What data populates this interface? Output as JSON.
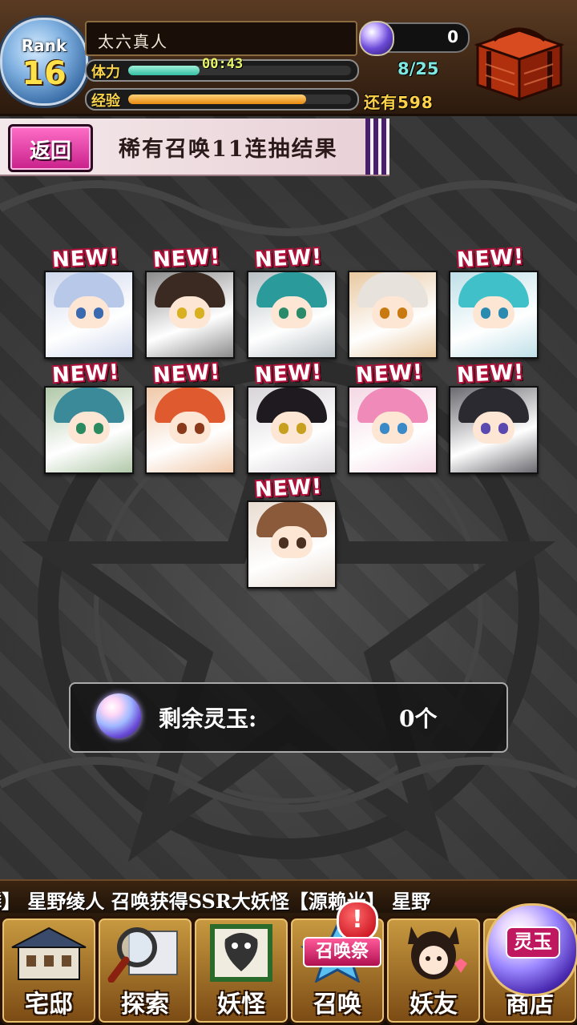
{
  "player": {
    "rank_label": "Rank",
    "rank": "16",
    "name": "太六真人",
    "stamina_label": "体力",
    "stamina_timer": "00:43",
    "stamina": "8/25",
    "stamina_fraction": 0.32,
    "exp_label": "经验",
    "exp_remaining": "还有598",
    "exp_fraction": 0.8,
    "jade": "0"
  },
  "header": {
    "back_label": "返回",
    "title": "稀有召唤11连抽结果"
  },
  "results": {
    "new_label": "NEW!",
    "cards": [
      {
        "hair": "#b8c8e8",
        "bg": "#cfd8ec",
        "eyes": "#3a6ab0",
        "new": true
      },
      {
        "hair": "#3a2a22",
        "bg": "#8a8a8a",
        "eyes": "#d8b020",
        "new": true
      },
      {
        "hair": "#2a9a9a",
        "bg": "#b8c0c4",
        "eyes": "#2a8a6a",
        "new": true
      },
      {
        "hair": "#e8e2dc",
        "bg": "#e8c8a0",
        "eyes": "#c87a10",
        "new": false
      },
      {
        "hair": "#40c0c8",
        "bg": "#bfe0e8",
        "eyes": "#2a8ab0",
        "new": true
      },
      {
        "hair": "#3a8a9a",
        "bg": "#b0c8a8",
        "eyes": "#2a8a60",
        "new": true
      },
      {
        "hair": "#e05a30",
        "bg": "#f0c8a8",
        "eyes": "#8a3a1a",
        "new": true
      },
      {
        "hair": "#1e1a20",
        "bg": "#d8d4d8",
        "eyes": "#c8a020",
        "new": true
      },
      {
        "hair": "#f08ab8",
        "bg": "#f4d8e4",
        "eyes": "#3a8ac8",
        "new": true
      },
      {
        "hair": "#2a2a30",
        "bg": "#6a6a70",
        "eyes": "#5a4ab0",
        "new": true
      },
      {
        "hair": "#8a5a3a",
        "bg": "#e8dcd0",
        "eyes": "#4a3020",
        "new": true
      }
    ]
  },
  "remaining": {
    "label": "剩余灵玉:",
    "value": "0个"
  },
  "ticker": {
    "text": "麒麟】  星野绫人 召唤获得SSR大妖怪【源赖光】  星野"
  },
  "nav": {
    "items": [
      {
        "label": "宅邸"
      },
      {
        "label": "探索"
      },
      {
        "label": "妖怪"
      },
      {
        "label": "召唤"
      },
      {
        "label": "妖友"
      },
      {
        "label": "商店"
      }
    ],
    "alert": "!",
    "festival_tag": "召唤祭",
    "shop_tag": "灵玉"
  }
}
